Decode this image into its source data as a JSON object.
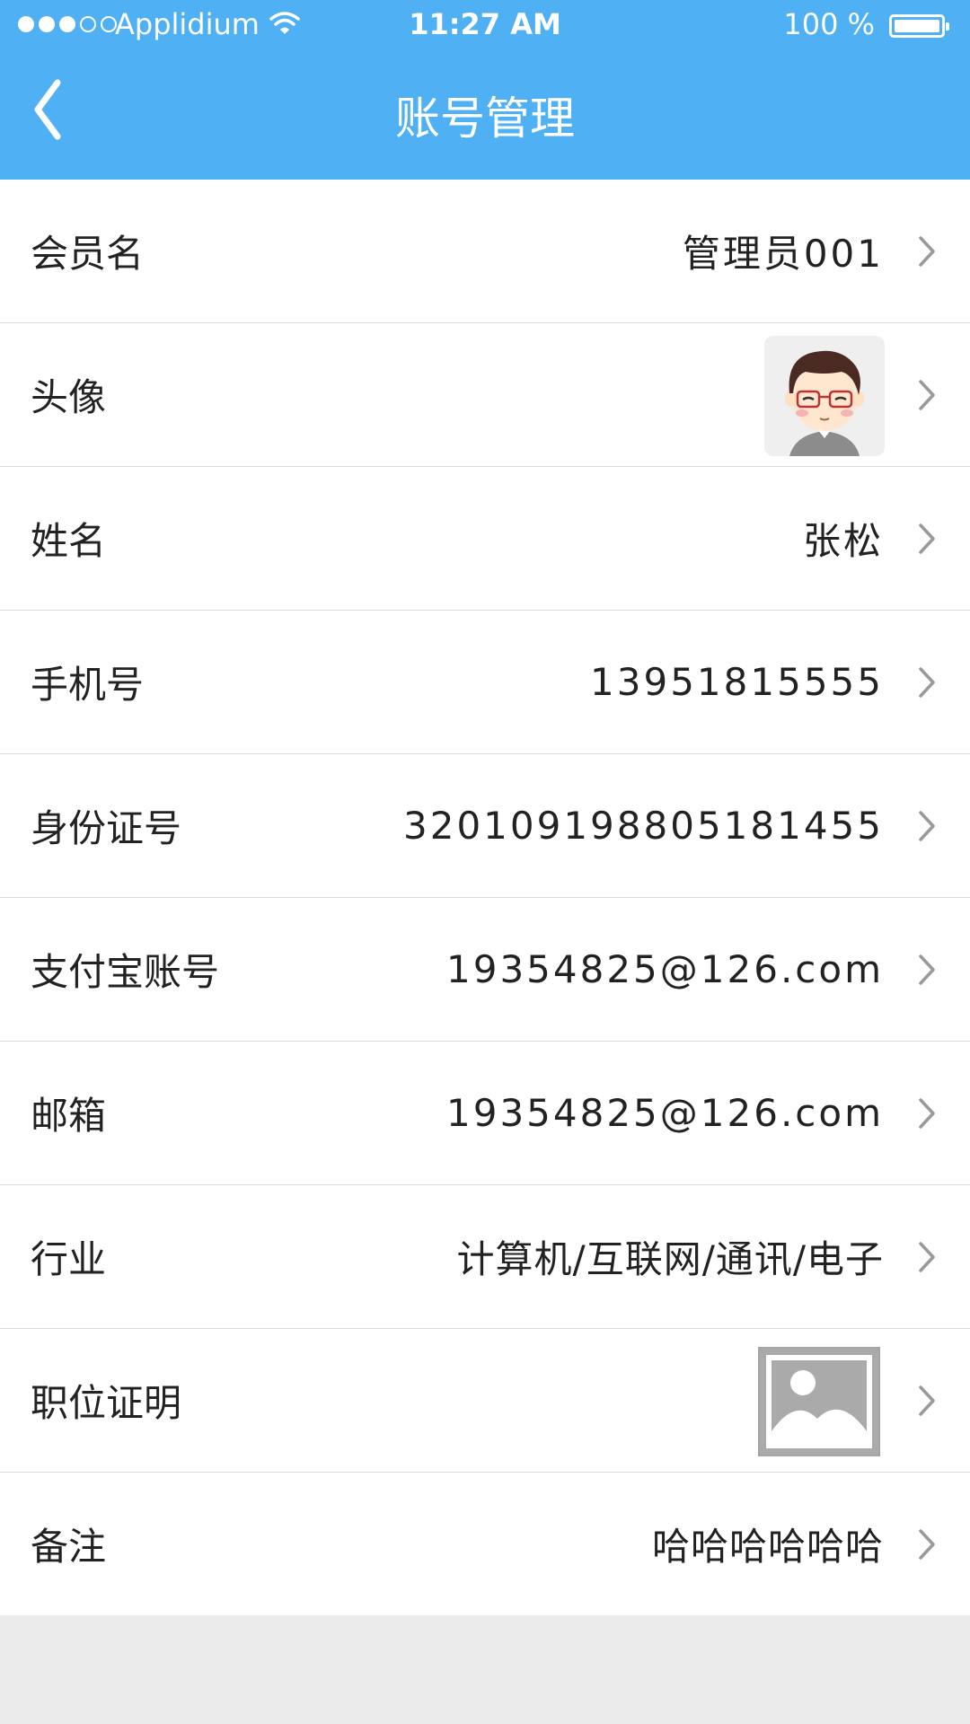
{
  "status_bar": {
    "carrier": "Applidium",
    "time": "11:27 AM",
    "battery": "100 %",
    "signal_bars_filled": 3,
    "signal_bars_total": 5
  },
  "nav": {
    "title": "账号管理",
    "back_icon": "chevron-left-icon"
  },
  "theme": {
    "accent": "#4fb1f3",
    "background": "#ebebeb"
  },
  "rows": [
    {
      "label": "会员名",
      "value": "管理员001"
    },
    {
      "label": "头像",
      "icon": "avatar"
    },
    {
      "label": "姓名",
      "value": "张松"
    },
    {
      "label": "手机号",
      "value": "13951815555"
    },
    {
      "label": "身份证号",
      "value": "320109198805181455"
    },
    {
      "label": "支付宝账号",
      "value": "19354825@126.com"
    },
    {
      "label": "邮箱",
      "value": "19354825@126.com"
    },
    {
      "label": "行业",
      "value": "计算机/互联网/通讯/电子"
    },
    {
      "label": "职位证明",
      "icon": "image-placeholder-icon"
    },
    {
      "label": "备注",
      "value": "哈哈哈哈哈哈"
    }
  ]
}
